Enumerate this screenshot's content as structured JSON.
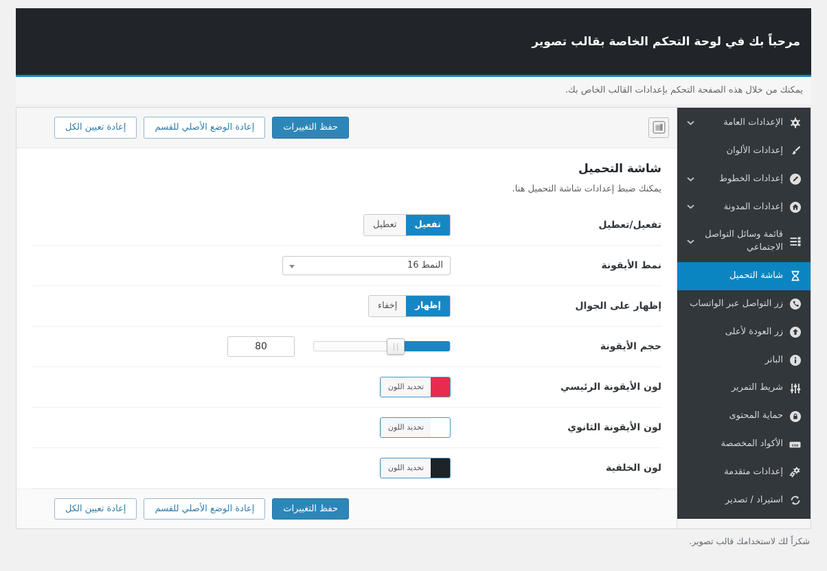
{
  "header": {
    "title": "مرحباً بك في لوحة التحكم الخاصة بقالب تصوير",
    "subtitle": "يمكنك من خلال هذه الصفحة التحكم بإعدادات القالب الخاص بك."
  },
  "colors": {
    "accent_blue": "#0a85c2",
    "save_button_blue": "#2e86b8",
    "toggle_active_blue": "#1787c4",
    "header_dark": "#212529",
    "sidebar_dark": "#32373c"
  },
  "toolbar": {
    "save_label": "حفظ التغييرات",
    "reset_section_label": "إعادة الوضع الأصلي للقسم",
    "reset_all_label": "إعادة تعيين الكل"
  },
  "section": {
    "title": "شاشة التحميل",
    "description": "يمكنك ضبط إعدادات شاشة التحميل هنا."
  },
  "settings": {
    "enable": {
      "label": "تفعيل/تعطيل",
      "on_label": "تفعيل",
      "off_label": "تعطيل",
      "value": "تفعيل"
    },
    "icon_style": {
      "label": "نمط الأيقونة",
      "value": "النمط 16"
    },
    "mobile_visibility": {
      "label": "إظهار على الجوال",
      "on_label": "إظهار",
      "off_label": "إخفاء",
      "value": "إظهار"
    },
    "icon_size": {
      "label": "حجم الأيقونة",
      "value": "80"
    },
    "icon_primary_color": {
      "label": "لون الأيقونة الرئيسي",
      "button_label": "تحديد اللون",
      "color": "#e82c4c"
    },
    "icon_secondary_color": {
      "label": "لون الأيقونة الثانوي",
      "button_label": "تحديد اللون",
      "color": "#ffffff"
    },
    "background_color": {
      "label": "لون الخلفية",
      "button_label": "تحديد اللون",
      "color": "#1d2327"
    }
  },
  "sidebar": {
    "items": [
      {
        "label": "الإعدادات العامة",
        "icon": "gear-icon",
        "expandable": true,
        "active": false
      },
      {
        "label": "إعدادات الألوان",
        "icon": "paintbrush-icon",
        "expandable": false,
        "active": false
      },
      {
        "label": "إعدادات الخطوط",
        "icon": "pencil-circle-icon",
        "expandable": true,
        "active": false
      },
      {
        "label": "إعدادات المدونة",
        "icon": "home-circle-icon",
        "expandable": true,
        "active": false
      },
      {
        "label": "قائمة وسائل التواصل الاجتماعي",
        "icon": "list-icon",
        "expandable": true,
        "active": false
      },
      {
        "label": "شاشة التحميل",
        "icon": "hourglass-icon",
        "expandable": false,
        "active": true
      },
      {
        "label": "زر التواصل عبر الواتساب",
        "icon": "phone-circle-icon",
        "expandable": false,
        "active": false
      },
      {
        "label": "زر العودة لأعلى",
        "icon": "arrow-up-circle-icon",
        "expandable": false,
        "active": false
      },
      {
        "label": "البانر",
        "icon": "info-circle-icon",
        "expandable": false,
        "active": false
      },
      {
        "label": "شريط التمرير",
        "icon": "sliders-icon",
        "expandable": false,
        "active": false
      },
      {
        "label": "حماية المحتوى",
        "icon": "lock-circle-icon",
        "expandable": false,
        "active": false
      },
      {
        "label": "الأكواد المخصصة",
        "icon": "css-badge-icon",
        "expandable": false,
        "active": false
      },
      {
        "label": "إعدادات متقدمة",
        "icon": "gears-icon",
        "expandable": false,
        "active": false
      },
      {
        "label": "استيراد / تصدير",
        "icon": "sync-icon",
        "expandable": false,
        "active": false
      }
    ]
  },
  "footer": {
    "note": "شكراً لك لاستخدامك قالب تصوير."
  }
}
